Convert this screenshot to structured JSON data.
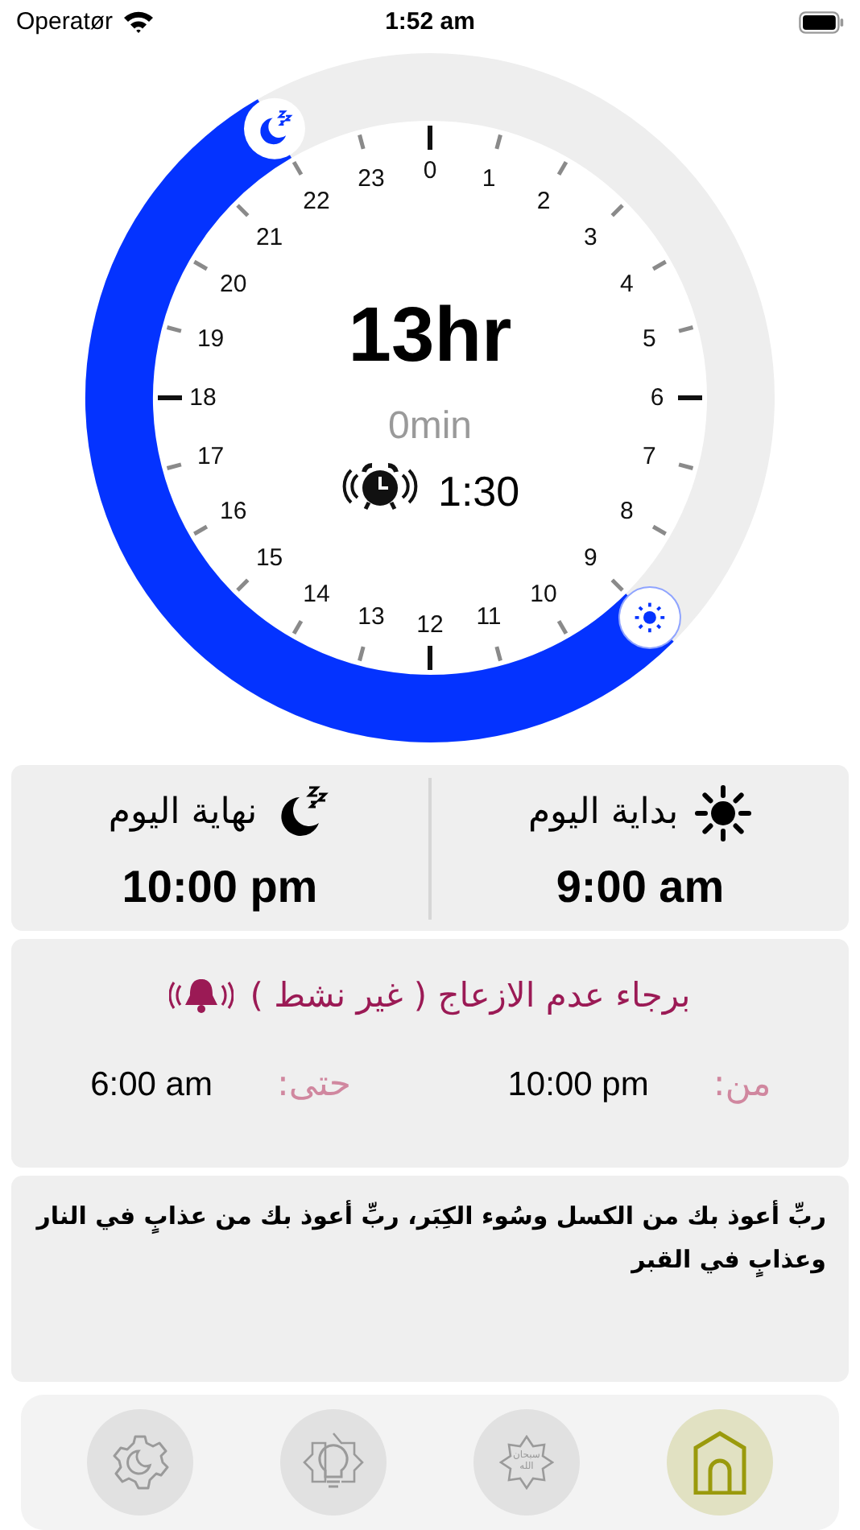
{
  "status_bar": {
    "carrier": "Operatør",
    "time": "1:52 am"
  },
  "clock": {
    "right_hour_labels": [
      "0",
      "1",
      "2",
      "3",
      "4",
      "5",
      "6",
      "7",
      "8",
      "9",
      "10",
      "11",
      "12"
    ],
    "left_hour_labels": [
      "23",
      "22",
      "21",
      "20",
      "19",
      "18",
      "17",
      "16",
      "15",
      "14",
      "13"
    ],
    "duration": "13hr",
    "minutes": "0min",
    "alarm_time": "1:30"
  },
  "day": [
    {
      "kind": "start",
      "label": "بداية اليوم",
      "time": "9:00 am"
    },
    {
      "kind": "end",
      "label": "نهاية اليوم",
      "time": "10:00 pm"
    }
  ],
  "dnd": {
    "title": "برجاء عدم الازعاج ( غير نشط )",
    "from_label": "من:",
    "from_time": "10:00 pm",
    "until_label": "حتى:",
    "until_time": "6:00 am"
  },
  "dua": {
    "text": "ربِّ أعوذ بك من الكسل وسُوء الكِبَر، ربِّ أعوذ بك من عذابٍ في النار وعذابٍ في القبر"
  },
  "tabs": [
    {
      "kind": "home",
      "selected": true
    },
    {
      "kind": "tasbih",
      "selected": false,
      "badge_text": "سبحان الله"
    },
    {
      "kind": "bulb",
      "selected": false
    },
    {
      "kind": "settings",
      "selected": false
    }
  ]
}
